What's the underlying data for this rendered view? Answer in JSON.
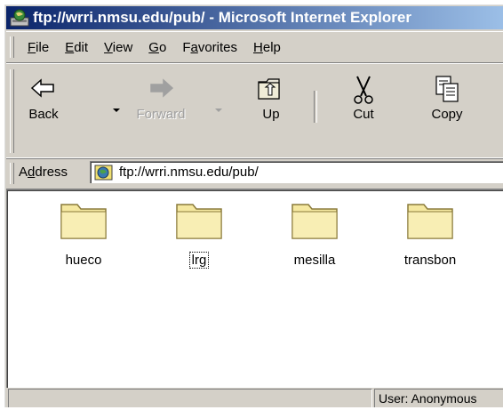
{
  "window": {
    "title": "ftp://wrri.nmsu.edu/pub/ - Microsoft Internet Explorer"
  },
  "menu": [
    {
      "label_pre": "",
      "label_key": "F",
      "label_post": "ile"
    },
    {
      "label_pre": "",
      "label_key": "E",
      "label_post": "dit"
    },
    {
      "label_pre": "",
      "label_key": "V",
      "label_post": "iew"
    },
    {
      "label_pre": "",
      "label_key": "G",
      "label_post": "o"
    },
    {
      "label_pre": "F",
      "label_key": "a",
      "label_post": "vorites"
    },
    {
      "label_pre": "",
      "label_key": "H",
      "label_post": "elp"
    }
  ],
  "toolbar": {
    "back": {
      "label": "Back",
      "icon": "back-arrow-icon"
    },
    "forward": {
      "label": "Forward",
      "icon": "forward-arrow-icon"
    },
    "up": {
      "label": "Up",
      "icon": "up-folder-icon"
    },
    "cut": {
      "label": "Cut",
      "icon": "scissors-icon"
    },
    "copy": {
      "label": "Copy",
      "icon": "copy-icon"
    }
  },
  "address": {
    "label_pre": "A",
    "label_key": "d",
    "label_post": "dress",
    "value": "ftp://wrri.nmsu.edu/pub/"
  },
  "folders": [
    {
      "name": "hueco"
    },
    {
      "name": "lrg"
    },
    {
      "name": "mesilla"
    },
    {
      "name": "transbon"
    }
  ],
  "status": {
    "left": "",
    "user": "User: Anonymous"
  },
  "colors": {
    "title_gradient_start": "#0a246a",
    "title_gradient_end": "#a6caf0",
    "chrome": "#d4d0c8",
    "folder_fill": "#f5e8a0",
    "folder_outline": "#8a7a3a"
  }
}
